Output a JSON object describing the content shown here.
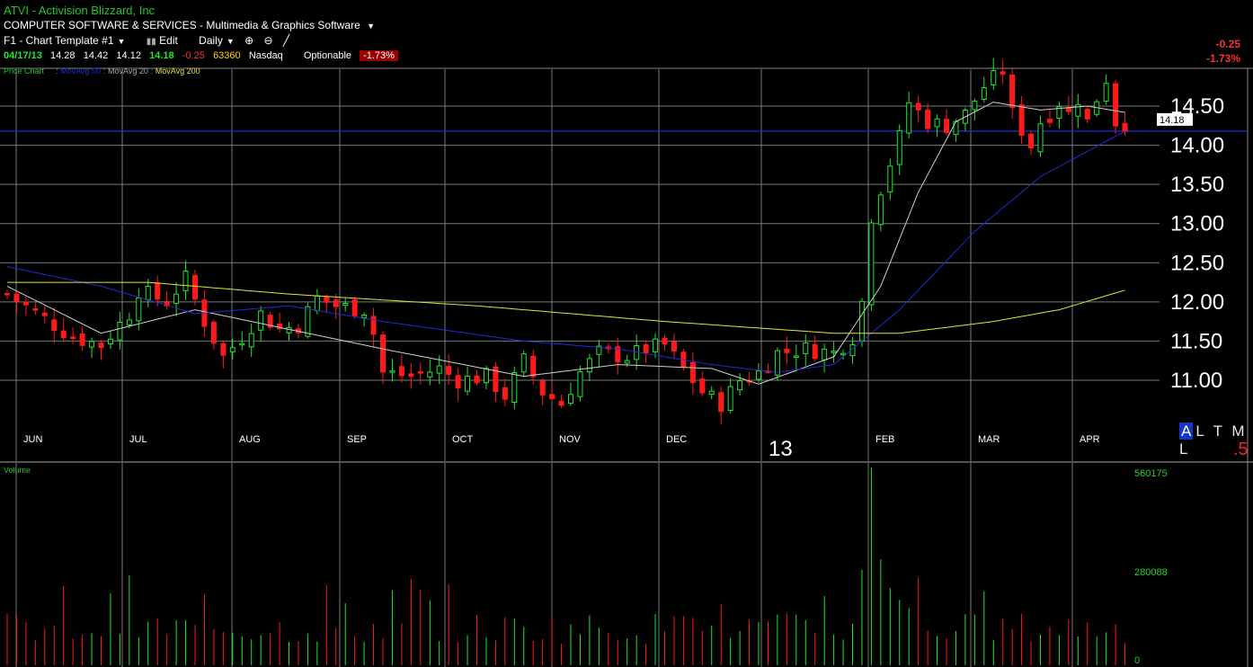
{
  "header": {
    "symbol": "ATVI",
    "company": "Activision Blizzard, Inc",
    "sector": "COMPUTER SOFTWARE & SERVICES",
    "industry": "Multimedia & Graphics Software",
    "template_label": "F1 - Chart Template #1",
    "edit_label": "Edit",
    "period_label": "Daily",
    "quote": {
      "date": "04/17/13",
      "open": "14.28",
      "high": "14.42",
      "low": "14.12",
      "close": "14.18",
      "change": "-0.25",
      "volume": "63360",
      "exchange": "Nasdaq",
      "optionable": "Optionable",
      "change_pct": "-1.73%"
    },
    "top_right_change": "-0.25",
    "top_right_pct": "-1.73%"
  },
  "legend": {
    "price_chart": "Price Chart",
    "ma50": "MovAvg 50",
    "ma20": "MovAvg 20",
    "ma200": "MovAvg 200",
    "volume": "Volume"
  },
  "altml": {
    "highlight": "A",
    "rest": "L T M L",
    "sub": ".5"
  },
  "colors": {
    "up": "#1ee82e",
    "down": "#ff1a1a",
    "ma20": "#cfcfcf",
    "ma50": "#1c2cd8",
    "ma200": "#e6e23a",
    "price_line": "#1c2cd8",
    "grid": "#7a7a7a",
    "header_green": "#22c32a",
    "badge_red": "#9b0000"
  },
  "chart_data": [
    {
      "type": "candlestick",
      "title": "ATVI - Activision Blizzard, Inc",
      "x_labels": [
        "JUN",
        "JUL",
        "AUG",
        "SEP",
        "OCT",
        "NOV",
        "DEC",
        "13",
        "FEB",
        "MAR",
        "APR"
      ],
      "ylim": [
        10.5,
        15.0
      ],
      "y_ticks": [
        "11.00",
        "11.50",
        "12.00",
        "12.50",
        "13.00",
        "13.50",
        "14.00",
        "14.50"
      ],
      "current_price_label": "14.18",
      "last_bar": {
        "date": "04/17/13",
        "open": 14.28,
        "high": 14.42,
        "low": 14.12,
        "close": 14.18
      },
      "price_path": [
        [
          0,
          12.1
        ],
        [
          7,
          11.55
        ],
        [
          10,
          11.45
        ],
        [
          13,
          11.85
        ],
        [
          14,
          12.15
        ],
        [
          17,
          12.0
        ],
        [
          19,
          12.3
        ],
        [
          21,
          11.75
        ],
        [
          23,
          11.3
        ],
        [
          25,
          11.55
        ],
        [
          27,
          11.85
        ],
        [
          29,
          11.65
        ],
        [
          31,
          11.7
        ],
        [
          33,
          12.05
        ],
        [
          35,
          11.95
        ],
        [
          38,
          11.9
        ],
        [
          39,
          11.6
        ],
        [
          40,
          11.1
        ],
        [
          43,
          11.05
        ],
        [
          46,
          11.15
        ],
        [
          48,
          11.0
        ],
        [
          51,
          11.05
        ],
        [
          53,
          10.8
        ],
        [
          55,
          11.25
        ],
        [
          57,
          10.85
        ],
        [
          59,
          10.7
        ],
        [
          61,
          11.1
        ],
        [
          63,
          11.35
        ],
        [
          66,
          11.3
        ],
        [
          68,
          11.4
        ],
        [
          70,
          11.45
        ],
        [
          72,
          11.15
        ],
        [
          74,
          10.85
        ],
        [
          76,
          10.7
        ],
        [
          78,
          11.0
        ],
        [
          80,
          11.1
        ],
        [
          82,
          11.35
        ],
        [
          85,
          11.4
        ],
        [
          88,
          11.35
        ],
        [
          90,
          11.55
        ],
        [
          91,
          12.0
        ],
        [
          92,
          13.1
        ],
        [
          93,
          13.45
        ],
        [
          95,
          14.1
        ],
        [
          96,
          14.55
        ],
        [
          98,
          14.3
        ],
        [
          100,
          14.25
        ],
        [
          102,
          14.4
        ],
        [
          104,
          14.75
        ],
        [
          105,
          14.85
        ],
        [
          106,
          14.95
        ],
        [
          107,
          14.4
        ],
        [
          108,
          14.2
        ],
        [
          109,
          14.0
        ],
        [
          110,
          14.3
        ],
        [
          111,
          14.4
        ],
        [
          112,
          14.55
        ],
        [
          113,
          14.4
        ],
        [
          114,
          14.6
        ],
        [
          115,
          14.3
        ],
        [
          116,
          14.6
        ],
        [
          117,
          14.85
        ],
        [
          118,
          14.3
        ],
        [
          119,
          14.18
        ]
      ],
      "moving_averages": [
        {
          "name": "MovAvg 20",
          "values": [
            [
              0,
              12.2
            ],
            [
              10,
              11.6
            ],
            [
              20,
              11.9
            ],
            [
              40,
              11.4
            ],
            [
              55,
              11.05
            ],
            [
              65,
              11.2
            ],
            [
              75,
              11.15
            ],
            [
              80,
              10.95
            ],
            [
              88,
              11.3
            ],
            [
              93,
              12.2
            ],
            [
              97,
              13.4
            ],
            [
              101,
              14.3
            ],
            [
              105,
              14.55
            ],
            [
              110,
              14.45
            ],
            [
              115,
              14.5
            ],
            [
              119,
              14.42
            ]
          ]
        },
        {
          "name": "MovAvg 50",
          "values": [
            [
              0,
              12.45
            ],
            [
              10,
              12.2
            ],
            [
              20,
              11.85
            ],
            [
              30,
              11.95
            ],
            [
              40,
              11.75
            ],
            [
              55,
              11.5
            ],
            [
              65,
              11.4
            ],
            [
              75,
              11.2
            ],
            [
              82,
              11.1
            ],
            [
              88,
              11.2
            ],
            [
              95,
              11.9
            ],
            [
              103,
              12.9
            ],
            [
              110,
              13.6
            ],
            [
              119,
              14.18
            ]
          ]
        },
        {
          "name": "MovAvg 200",
          "values": [
            [
              0,
              12.25
            ],
            [
              15,
              12.25
            ],
            [
              30,
              12.1
            ],
            [
              50,
              11.95
            ],
            [
              70,
              11.75
            ],
            [
              88,
              11.6
            ],
            [
              95,
              11.6
            ],
            [
              105,
              11.75
            ],
            [
              112,
              11.9
            ],
            [
              119,
              12.15
            ]
          ]
        }
      ]
    },
    {
      "type": "bar",
      "title": "Volume",
      "ylim": [
        0,
        560175
      ],
      "y_ticks": [
        "0",
        "280088",
        "560175"
      ],
      "peak_volume": 560175,
      "last_volume": 63360
    }
  ]
}
